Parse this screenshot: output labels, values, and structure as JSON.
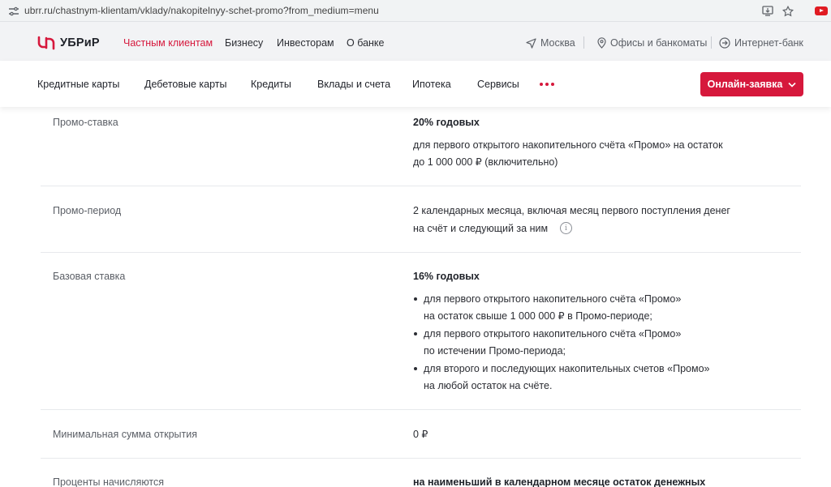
{
  "browser": {
    "url": "ubrr.ru/chastnym-klientam/vklady/nakopitelnyy-schet-promo?from_medium=menu",
    "icons": [
      "site-info-icon",
      "install-app-icon",
      "bookmark-star-icon",
      "youtube-icon"
    ]
  },
  "header": {
    "logo_text": "УБРиР",
    "top_nav": [
      "Частным клиентам",
      "Бизнесу",
      "Инвесторам",
      "О банке"
    ],
    "city": "Москва",
    "offices": "Офисы и банкоматы",
    "internet_bank": "Интернет-банк",
    "accent_color": "#d6183c"
  },
  "sub_nav": {
    "items": [
      "Кредитные карты",
      "Дебетовые карты",
      "Кредиты",
      "Вклады и счета",
      "Ипотека",
      "Сервисы"
    ],
    "more_icon": "more-dots-icon",
    "cta_label": "Онлайн-заявка"
  },
  "conditions": [
    {
      "label": "Промо-ставка",
      "title": "20% годовых",
      "lines": [
        "для первого открытого накопительного счёта «Промо» на остаток",
        "до 1 000 000 ₽ (включительно)"
      ]
    },
    {
      "label": "Промо-период",
      "lines": [
        "2 календарных месяца, включая месяц первого поступления денег",
        "на счёт и следующий за ним"
      ],
      "info_icon": "info-icon"
    },
    {
      "label": "Базовая ставка",
      "title": "16% годовых",
      "bullets": [
        [
          "для первого открытого накопительного счёта «Промо»",
          "на остаток свыше 1 000 000 ₽ в Промо-периоде;"
        ],
        [
          "для первого открытого накопительного счёта «Промо»",
          "по истечении Промо-периода;"
        ],
        [
          "для второго и последующих накопительных счетов «Промо»",
          "на любой остаток на счёте."
        ]
      ]
    },
    {
      "label": "Минимальная сумма открытия",
      "value": "0 ₽"
    },
    {
      "label": "Проценты начисляются",
      "title": "на наименьший в календарном месяце остаток денежных"
    }
  ]
}
